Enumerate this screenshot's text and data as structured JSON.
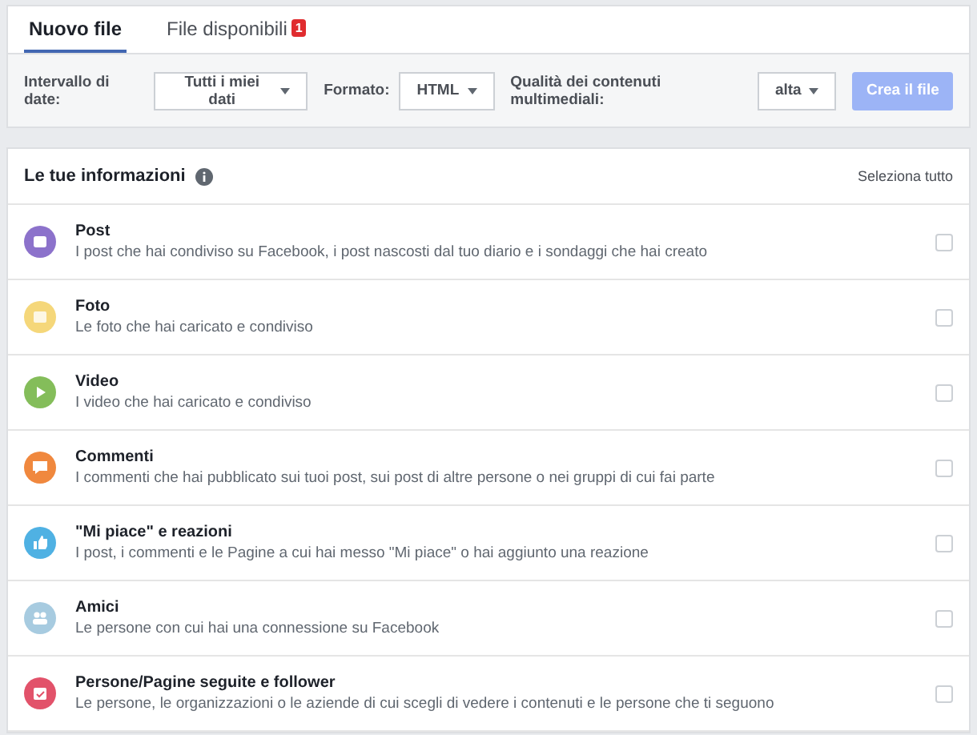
{
  "tabs": [
    {
      "label": "Nuovo file",
      "selected": true
    },
    {
      "label": "File disponibili",
      "selected": false,
      "badge": "1"
    }
  ],
  "toolbar": {
    "filters": [
      {
        "label": "Intervallo di date:",
        "value": "Tutti i miei dati"
      },
      {
        "label": "Formato:",
        "value": "HTML"
      },
      {
        "label": "Qualità dei contenuti multimediali:",
        "value": "alta"
      }
    ],
    "create_button": {
      "label": "Crea il file",
      "disabled": true
    }
  },
  "section": {
    "title": "Le tue informazioni",
    "select_all": "Seleziona tutto",
    "items": [
      {
        "kind": "post",
        "title": "Post",
        "description": "I post che hai condiviso su Facebook, i post nascosti dal tuo diario e i sondaggi che hai creato",
        "color": "#8c72cb",
        "checked": false
      },
      {
        "kind": "photo",
        "title": "Foto",
        "description": "Le foto che hai caricato e condiviso",
        "color": "#f5d77a",
        "checked": false
      },
      {
        "kind": "video",
        "title": "Video",
        "description": "I video che hai caricato e condiviso",
        "color": "#84bd5a",
        "checked": false
      },
      {
        "kind": "comment",
        "title": "Commenti",
        "description": "I commenti che hai pubblicato sui tuoi post, sui post di altre persone o nei gruppi di cui fai parte",
        "color": "#f0883e",
        "checked": false
      },
      {
        "kind": "like",
        "title": "\"Mi piace\" e reazioni",
        "description": "I post, i commenti e le Pagine a cui hai messo \"Mi piace\" o hai aggiunto una reazione",
        "color": "#4fb1e3",
        "checked": false
      },
      {
        "kind": "friends",
        "title": "Amici",
        "description": "Le persone con cui hai una connessione su Facebook",
        "color": "#a7cbe0",
        "checked": false
      },
      {
        "kind": "follow",
        "title": "Persone/Pagine seguite e follower",
        "description": "Le persone, le organizzazioni o le aziende di cui scegli di vedere i contenuti e le persone che ti seguono",
        "color": "#e2526a",
        "checked": false
      }
    ]
  }
}
